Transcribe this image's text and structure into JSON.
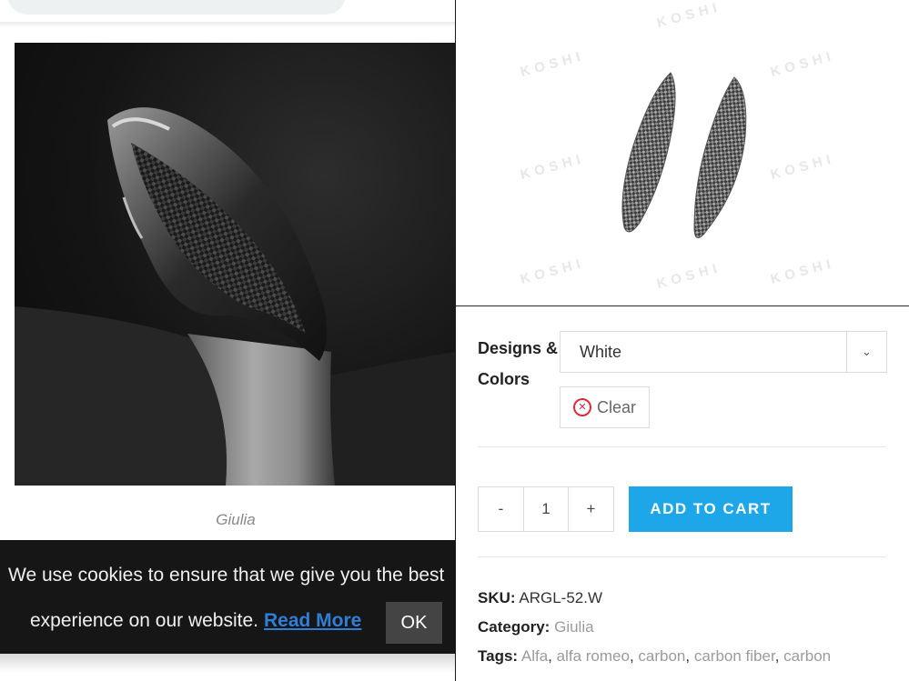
{
  "gallery": {
    "caption": "Giulia"
  },
  "cookie_banner": {
    "line1": "We use cookies to ensure that we give you the best",
    "line2": "experience on our website.",
    "read_more": "Read More",
    "ok": "OK"
  },
  "product": {
    "watermark": "KOSHI",
    "option_label_line1": "Designs &",
    "option_label_line2": "Colors",
    "option_value": "White",
    "clear_label": "Clear",
    "quantity": "1",
    "minus": "-",
    "plus": "+",
    "add_to_cart": "ADD TO CART",
    "sku_label": "SKU:",
    "sku_value": "ARGL-52.W",
    "category_label": "Category:",
    "category_value": "Giulia",
    "tags_label": "Tags:",
    "tags": [
      "Alfa",
      "alfa romeo",
      "carbon",
      "carbon fiber",
      "carbon"
    ]
  },
  "colors": {
    "accent": "#1ea7e8",
    "clear_icon": "#e0283a",
    "read_more_link": "#2f7fd8",
    "cookie_bg": "#161616"
  },
  "icons": [
    "chevron-down-icon",
    "clear-x-icon"
  ]
}
